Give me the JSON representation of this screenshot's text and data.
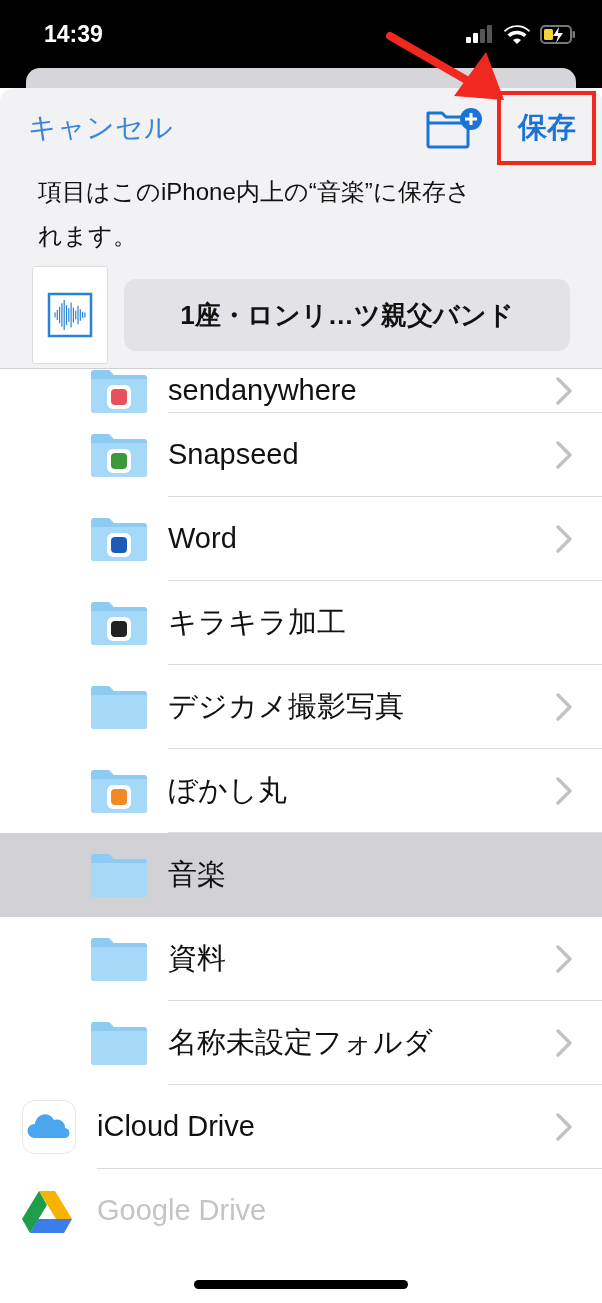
{
  "status_bar": {
    "time": "14:39"
  },
  "header": {
    "cancel": "キャンセル",
    "save": "保存",
    "description": "項目はこのiPhone内上の“音楽”に保存されます。",
    "file_name": "1座・ロンリ…ツ親父バンド"
  },
  "annotations": {
    "save_highlight": true,
    "arrow": true
  },
  "items": [
    {
      "kind": "app_folder",
      "label": "sendanywhere",
      "color": "#e8505b",
      "expandable": true,
      "selected": false,
      "disabled": false
    },
    {
      "kind": "app_folder",
      "label": "Snapseed",
      "color": "#3a9a3a",
      "expandable": true,
      "selected": false,
      "disabled": false
    },
    {
      "kind": "app_folder",
      "label": "Word",
      "color": "#1e5bb8",
      "expandable": true,
      "selected": false,
      "disabled": false
    },
    {
      "kind": "app_folder",
      "label": "キラキラ加工",
      "color": "#222222",
      "expandable": false,
      "selected": false,
      "disabled": false
    },
    {
      "kind": "folder",
      "label": "デジカメ撮影写真",
      "expandable": true,
      "selected": false,
      "disabled": false
    },
    {
      "kind": "app_folder",
      "label": "ぼかし丸",
      "color": "#f08a24",
      "expandable": true,
      "selected": false,
      "disabled": false
    },
    {
      "kind": "folder",
      "label": "音楽",
      "expandable": false,
      "selected": true,
      "disabled": false
    },
    {
      "kind": "folder",
      "label": "資料",
      "expandable": true,
      "selected": false,
      "disabled": false
    },
    {
      "kind": "folder",
      "label": "名称未設定フォルダ",
      "expandable": true,
      "selected": false,
      "disabled": false
    },
    {
      "kind": "cloud",
      "label": "iCloud Drive",
      "expandable": true,
      "selected": false,
      "disabled": false
    },
    {
      "kind": "drive",
      "label": "Google Drive",
      "expandable": false,
      "selected": false,
      "disabled": true
    }
  ]
}
